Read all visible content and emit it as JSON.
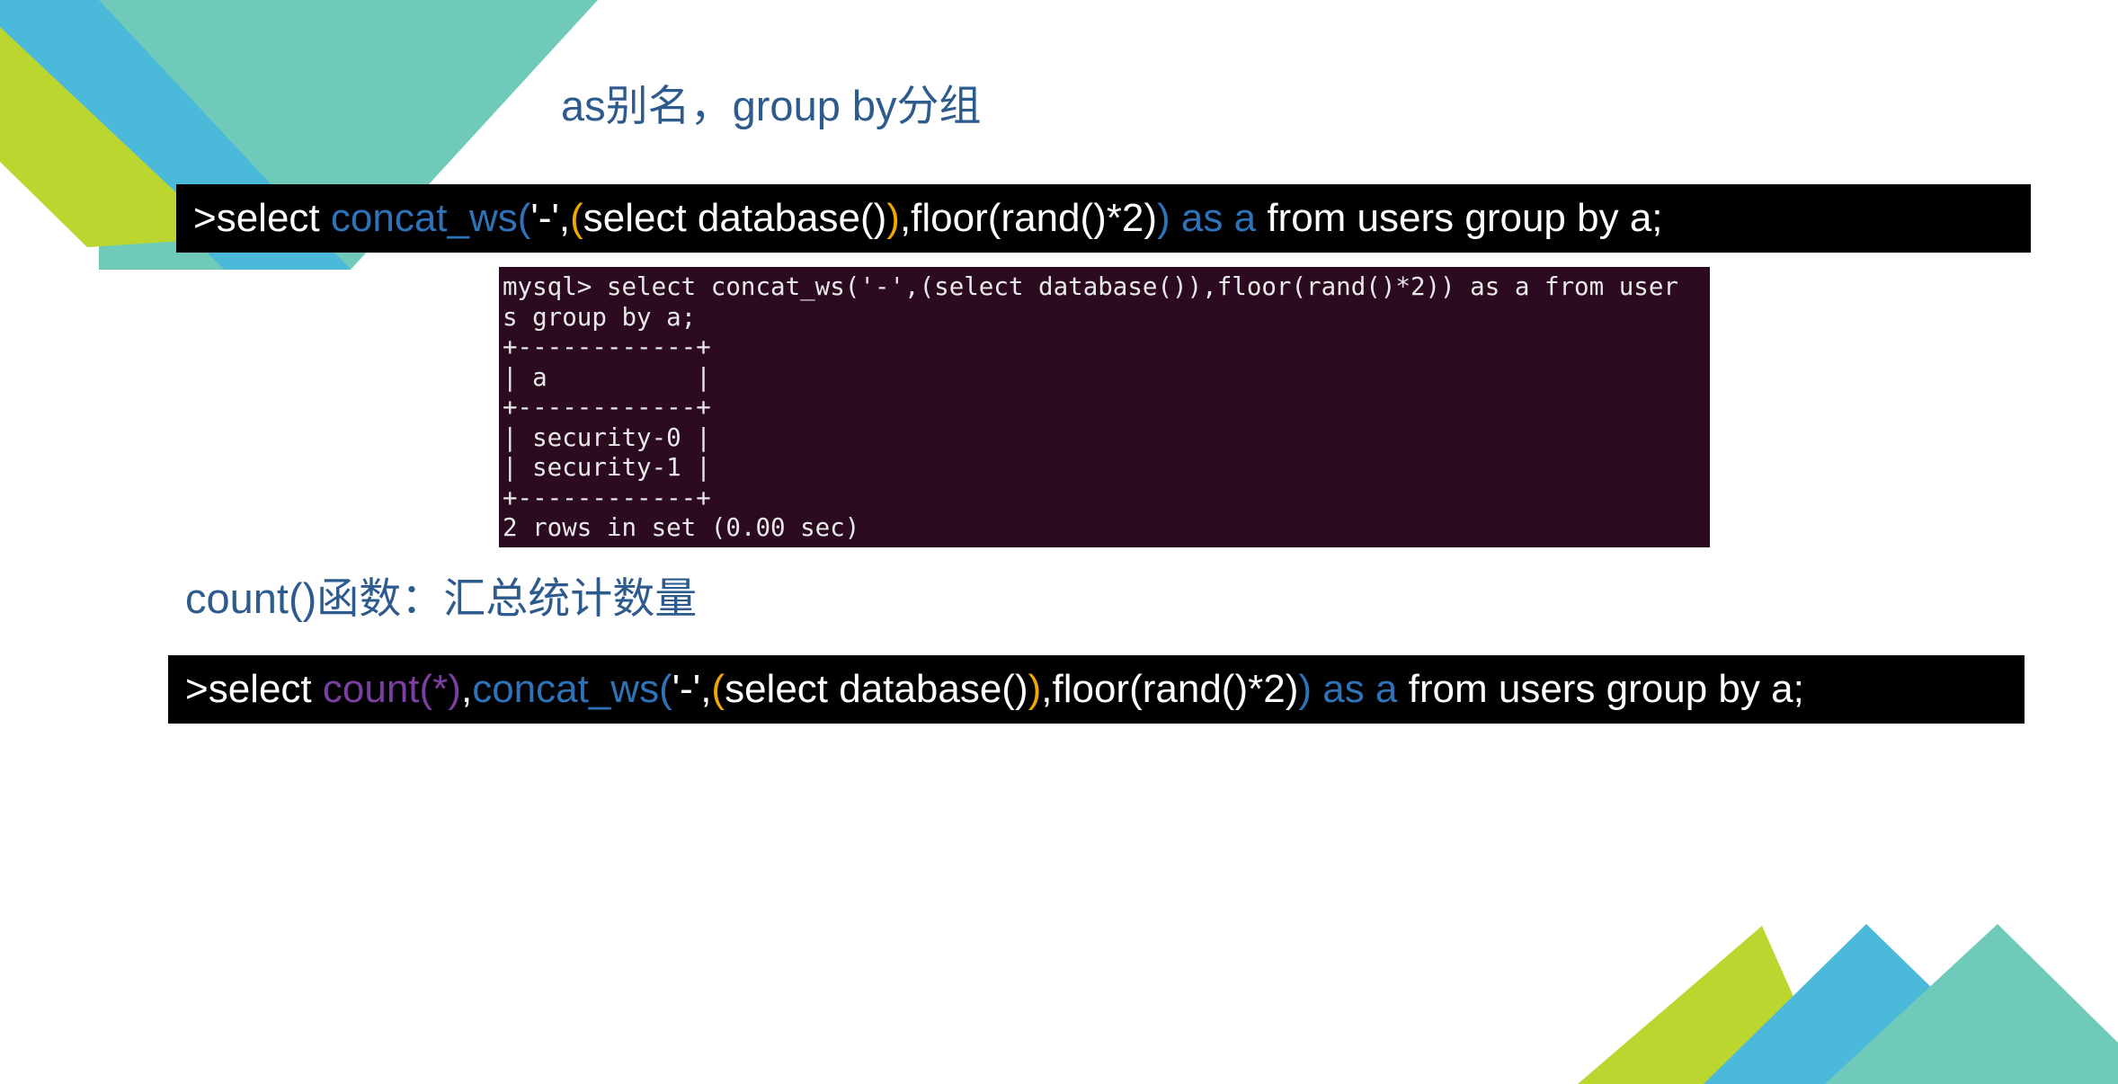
{
  "slide": {
    "heading1": "as别名，group by分组",
    "heading2": "count()函数：汇总统计数量",
    "command1": [
      {
        "text": ">select ",
        "style": "plain"
      },
      {
        "text": "concat_ws(",
        "style": "kw"
      },
      {
        "text": "'-',",
        "style": "plain"
      },
      {
        "text": "(",
        "style": "paren"
      },
      {
        "text": "select database()",
        "style": "plain"
      },
      {
        "text": ")",
        "style": "paren"
      },
      {
        "text": ",floor(rand()*2)",
        "style": "plain"
      },
      {
        "text": ") as a",
        "style": "kw"
      },
      {
        "text": " from users group by a;",
        "style": "plain"
      }
    ],
    "command2": [
      {
        "text": ">select ",
        "style": "plain"
      },
      {
        "text": "count(*)",
        "style": "count"
      },
      {
        "text": ",",
        "style": "plain"
      },
      {
        "text": "concat_ws(",
        "style": "kw"
      },
      {
        "text": "'-',",
        "style": "plain"
      },
      {
        "text": "(",
        "style": "paren"
      },
      {
        "text": "select database()",
        "style": "plain"
      },
      {
        "text": ")",
        "style": "paren"
      },
      {
        "text": ",floor(rand()*2)",
        "style": "plain"
      },
      {
        "text": ") as a",
        "style": "kw"
      },
      {
        "text": " from users group by a;",
        "style": "plain"
      }
    ],
    "terminal_lines": [
      "mysql> select concat_ws('-',(select database()),floor(rand()*2)) as a from user",
      "s group by a;",
      "+------------+",
      "| a          |",
      "+------------+",
      "| security-0 |",
      "| security-1 |",
      "+------------+",
      "2 rows in set (0.00 sec)"
    ]
  },
  "colors": {
    "heading": "#2e5b8e",
    "keyword": "#2e73b8",
    "paren": "#f0a800",
    "count": "#7a3fa0",
    "terminal_bg": "#2c0b21",
    "deco_green": "#bcd630",
    "deco_blue": "#4ab9da",
    "deco_teal": "#6fcaba"
  }
}
